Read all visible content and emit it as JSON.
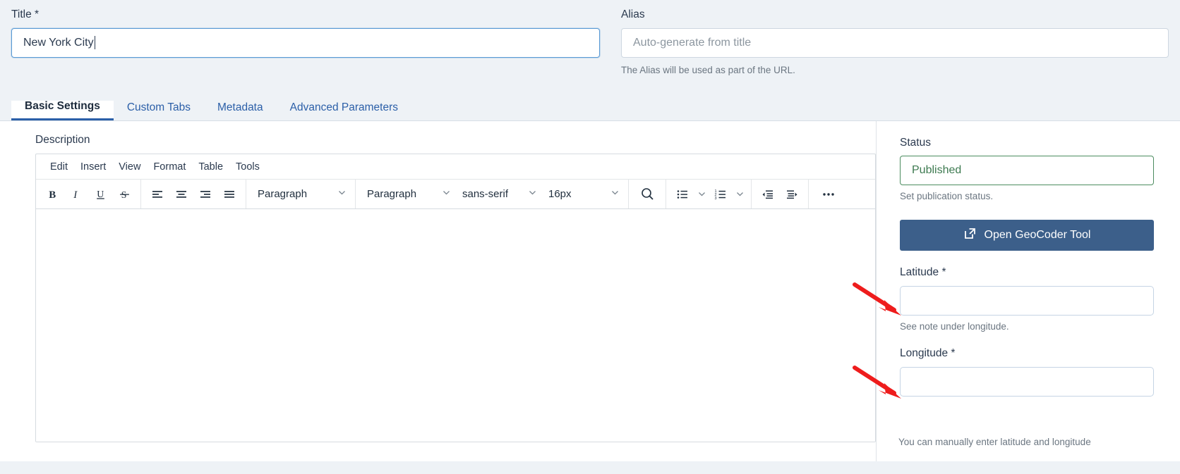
{
  "form": {
    "title_field": {
      "label": "Title *",
      "value": "New York City",
      "placeholder": ""
    },
    "alias_field": {
      "label": "Alias",
      "value": "",
      "placeholder": "Auto-generate from title",
      "help": "The Alias will be used as part of the URL."
    }
  },
  "tabs": [
    {
      "label": "Basic Settings",
      "active": true
    },
    {
      "label": "Custom Tabs",
      "active": false
    },
    {
      "label": "Metadata",
      "active": false
    },
    {
      "label": "Advanced Parameters",
      "active": false
    }
  ],
  "editor": {
    "label": "Description",
    "menus": [
      "Edit",
      "Insert",
      "View",
      "Format",
      "Table",
      "Tools"
    ],
    "format_buttons": [
      {
        "name": "bold-icon",
        "glyph": "B"
      },
      {
        "name": "italic-icon",
        "glyph": "I"
      },
      {
        "name": "underline-icon",
        "glyph": "U"
      },
      {
        "name": "strikethrough-icon",
        "glyph": "S"
      }
    ],
    "align_buttons": [
      {
        "name": "align-left-icon"
      },
      {
        "name": "align-center-icon"
      },
      {
        "name": "align-right-icon"
      },
      {
        "name": "align-justify-icon"
      }
    ],
    "selects": [
      {
        "name": "block-format-select",
        "value": "Paragraph"
      },
      {
        "name": "paragraph-style-select",
        "value": "Paragraph"
      },
      {
        "name": "font-family-select",
        "value": "sans-serif"
      },
      {
        "name": "font-size-select",
        "value": "16px"
      }
    ],
    "tool_buttons": [
      {
        "name": "search-icon"
      },
      {
        "name": "bullet-list-icon"
      },
      {
        "name": "numbered-list-icon"
      },
      {
        "name": "outdent-icon"
      },
      {
        "name": "indent-icon"
      },
      {
        "name": "more-options-icon"
      }
    ],
    "content": ""
  },
  "sidebar": {
    "status": {
      "label": "Status",
      "value": "Published",
      "help": "Set publication status.",
      "color": "#3d7a50"
    },
    "geocoder_button": {
      "label": "Open GeoCoder Tool",
      "icon": "external-link-icon",
      "color": "#3c5f8a"
    },
    "latitude": {
      "label": "Latitude *",
      "value": "",
      "help": "See note under longitude."
    },
    "longitude": {
      "label": "Longitude *",
      "value": "",
      "help": "You can manually enter latitude and longitude"
    }
  },
  "annotations": {
    "arrow_color": "#ee1c1c",
    "arrow_targets": [
      "Latitude *",
      "Longitude *"
    ]
  }
}
